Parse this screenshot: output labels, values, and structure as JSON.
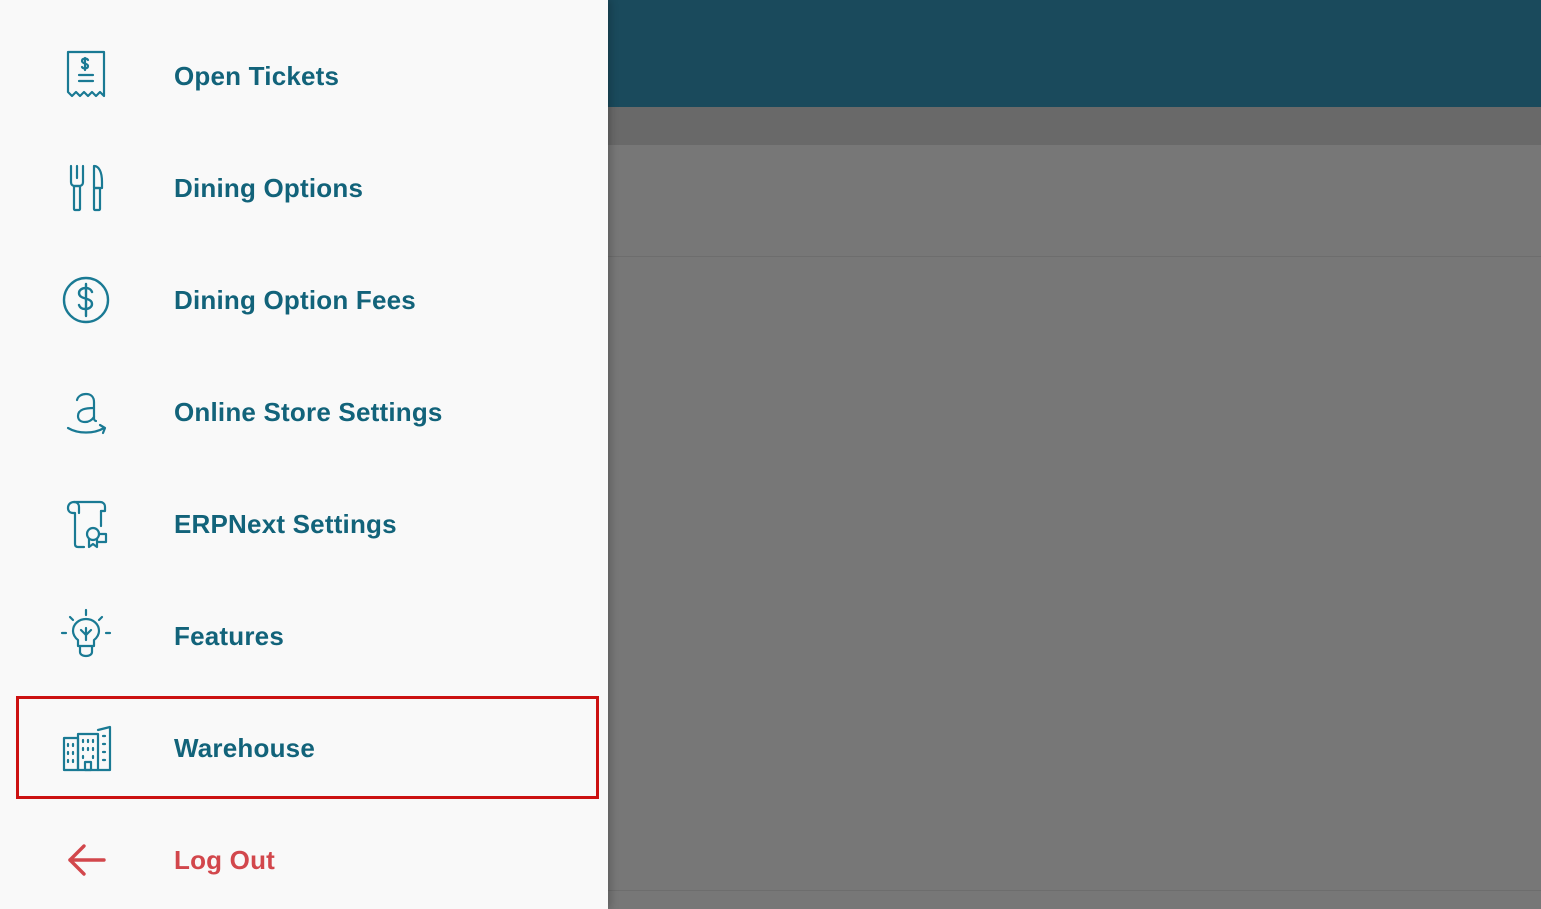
{
  "background": {
    "topbar_color": "#1a4a5c",
    "scrim_color": "#757575"
  },
  "drawer": {
    "items": [
      {
        "label": "Open Tickets",
        "icon": "receipt-icon"
      },
      {
        "label": "Dining Options",
        "icon": "fork-knife-icon"
      },
      {
        "label": "Dining Option Fees",
        "icon": "dollar-circle-icon"
      },
      {
        "label": "Online Store Settings",
        "icon": "amazon-icon"
      },
      {
        "label": "ERPNext Settings",
        "icon": "certificate-scroll-icon"
      },
      {
        "label": "Features",
        "icon": "lightbulb-icon"
      },
      {
        "label": "Warehouse",
        "icon": "buildings-icon"
      },
      {
        "label": "Log Out",
        "icon": "arrow-left-icon"
      }
    ],
    "highlighted_item": "Warehouse",
    "colors": {
      "item_text": "#12637a",
      "logout_text": "#d2474c",
      "icon": "#1a7a94",
      "highlight_border": "#cc1111"
    }
  }
}
